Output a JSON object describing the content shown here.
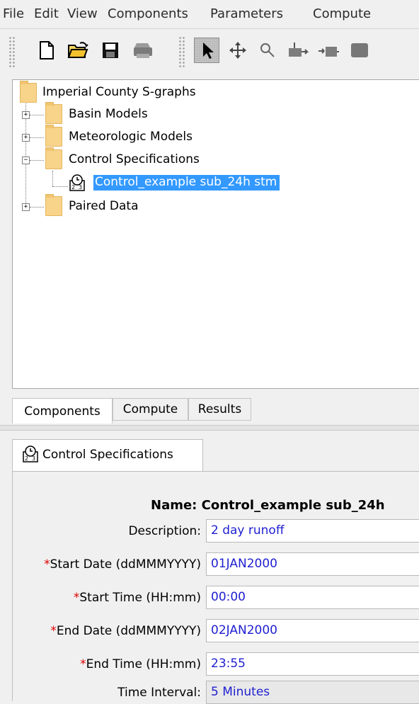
{
  "menu": [
    "File",
    "Edit",
    "View",
    "Components",
    "Parameters",
    "Compute"
  ],
  "toolbar": {
    "icons": [
      "new-file-icon",
      "open-folder-icon",
      "save-icon",
      "print-icon",
      "arrow-select-icon",
      "move-icon",
      "zoom-icon",
      "add-junction-icon",
      "add-sink-icon",
      "map-icon"
    ]
  },
  "tree": {
    "root": "Imperial County S-graphs",
    "items": [
      {
        "label": "Basin Models",
        "expanded": false
      },
      {
        "label": "Meteorologic Models",
        "expanded": false
      },
      {
        "label": "Control Specifications",
        "expanded": true
      },
      {
        "label": "Paired Data",
        "expanded": false
      }
    ],
    "child": "Control_example sub_24h stm"
  },
  "tabs": {
    "components": "Components",
    "compute": "Compute",
    "results": "Results"
  },
  "editor": {
    "tab_label": "Control Specifications",
    "name_label": "Name:",
    "name_value": "Control_example sub_24h",
    "fields": [
      {
        "label": "Description:",
        "required": false,
        "value": "2 day runoff"
      },
      {
        "label": "Start Date (ddMMMYYYY)",
        "required": true,
        "value": "01JAN2000"
      },
      {
        "label": "Start Time (HH:mm)",
        "required": true,
        "value": "00:00"
      },
      {
        "label": "End Date (ddMMMYYYY)",
        "required": true,
        "value": "02JAN2000"
      },
      {
        "label": "End Time (HH:mm)",
        "required": true,
        "value": "23:55"
      },
      {
        "label": "Time Interval:",
        "required": false,
        "value": "5 Minutes"
      }
    ],
    "asterisk": "*"
  },
  "colors": {
    "selection": "#3399ff",
    "field_text": "#1f1fd1",
    "required": "#e00000",
    "folder": "#f8d38a"
  }
}
